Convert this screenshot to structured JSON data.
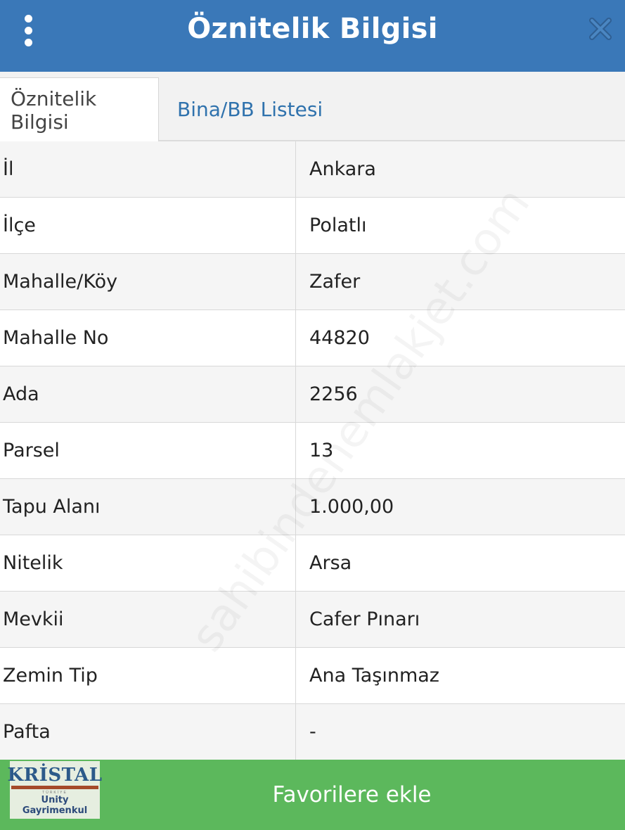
{
  "header": {
    "title": "Öznitelik Bilgisi",
    "menu_icon": "more-vertical-icon",
    "close_icon": "close-icon",
    "background_color": "#3a78b8"
  },
  "tabs": [
    {
      "label": "Öznitelik Bilgisi",
      "active": true
    },
    {
      "label": "Bina/BB Listesi",
      "active": false
    }
  ],
  "attributes": [
    {
      "key": "İl",
      "value": "Ankara"
    },
    {
      "key": "İlçe",
      "value": "Polatlı"
    },
    {
      "key": "Mahalle/Köy",
      "value": "Zafer"
    },
    {
      "key": "Mahalle No",
      "value": "44820"
    },
    {
      "key": "Ada",
      "value": "2256"
    },
    {
      "key": "Parsel",
      "value": "13"
    },
    {
      "key": "Tapu Alanı",
      "value": "1.000,00"
    },
    {
      "key": "Nitelik",
      "value": "Arsa"
    },
    {
      "key": "Mevkii",
      "value": "Cafer Pınarı"
    },
    {
      "key": "Zemin Tip",
      "value": "Ana Taşınmaz"
    },
    {
      "key": "Pafta",
      "value": "-"
    }
  ],
  "footer": {
    "button_label": "Favorilere ekle",
    "button_color": "#5cb85c",
    "logo": {
      "brand": "KRİSTAL",
      "sub": "TÜRKİYE",
      "line1": "Unity",
      "line2": "Gayrimenkul"
    }
  },
  "watermark": "sahibindenemlakjet.com"
}
